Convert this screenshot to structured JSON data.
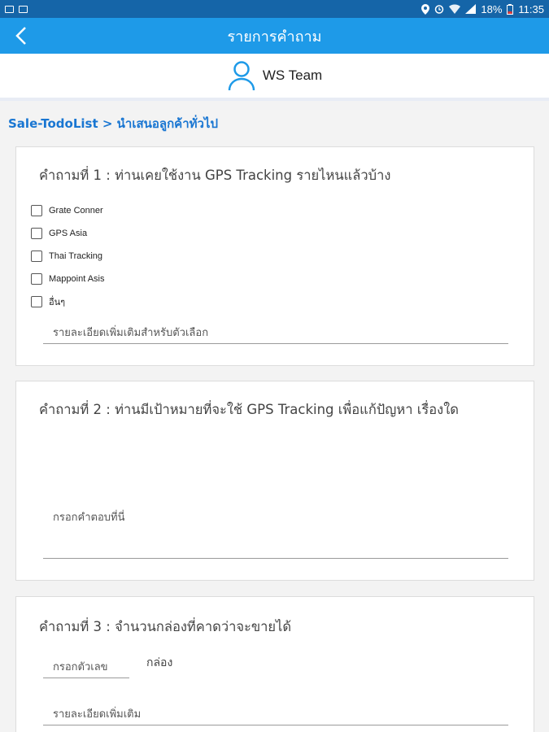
{
  "status_bar": {
    "battery": "18%",
    "time": "11:35"
  },
  "app_bar": {
    "title": "รายการคำถาม",
    "back_icon": "chevron-left-icon"
  },
  "user": {
    "name": "WS Team",
    "icon": "user-icon"
  },
  "breadcrumb": "Sale-TodoList > นำเสนอลูกค้าทั่วไป",
  "questions": [
    {
      "title": "คำถามที่ 1 : ท่านเคยใช้งาน GPS Tracking รายไหนแล้วบ้าง",
      "options": [
        "Grate Conner",
        "GPS Asia",
        "Thai Tracking",
        "Mappoint Asis",
        "อื่นๆ"
      ],
      "extra_placeholder": "รายละเอียดเพิ่มเติมสำหรับตัวเลือก"
    },
    {
      "title": "คำถามที่ 2 : ท่านมีเป้าหมายที่จะใช้ GPS Tracking เพื่อแก้ปัญหา เรื่องใด",
      "answer_placeholder": "กรอกคำตอบที่นี่"
    },
    {
      "title": "คำถามที่ 3 : จำนวนกล่องที่คาดว่าจะขายได้",
      "number_placeholder": "กรอกตัวเลข",
      "unit": "กล่อง",
      "extra_placeholder": "รายละเอียดเพิ่มเติม"
    }
  ],
  "colors": {
    "status_bar": "#1565a8",
    "app_bar": "#1e9ae8",
    "breadcrumb": "#1976d2",
    "user_icon": "#1e9ae8"
  }
}
